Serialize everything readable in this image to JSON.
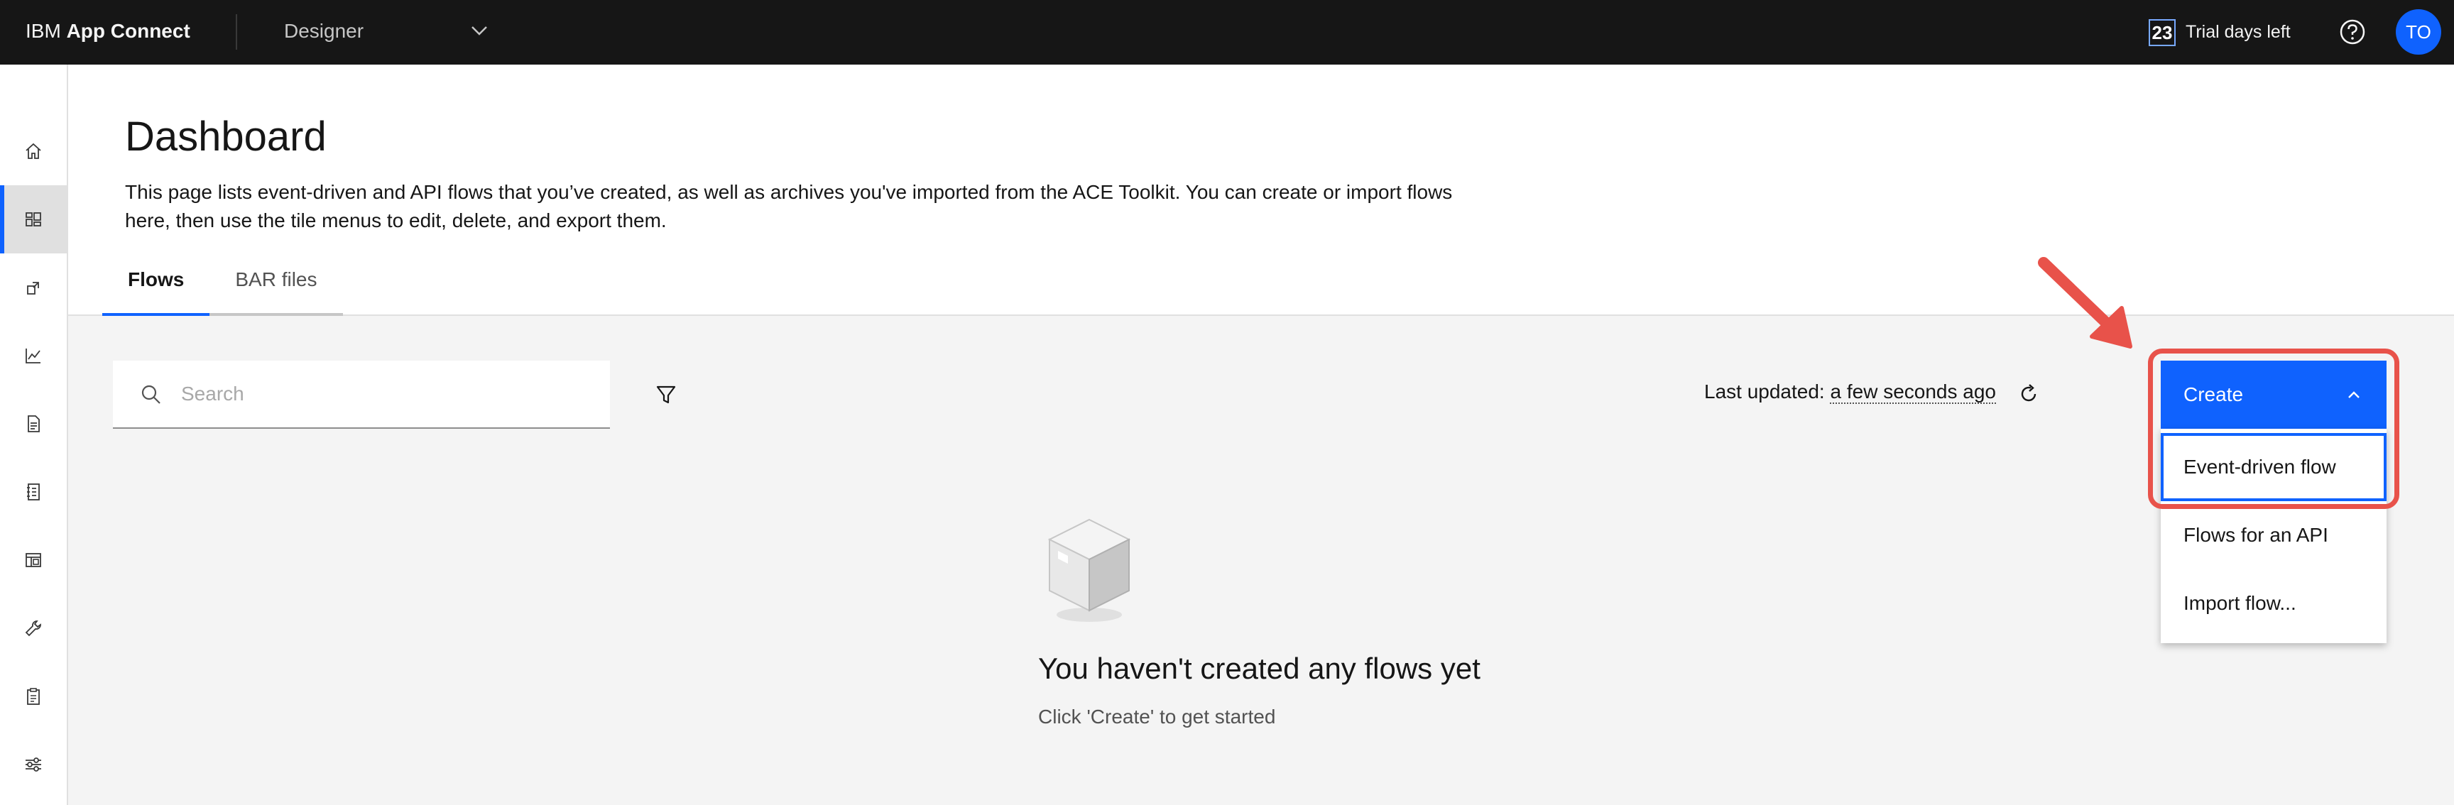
{
  "topbar": {
    "brand_prefix": "IBM ",
    "brand_name": "App Connect",
    "product": "Designer",
    "trial_days": "23",
    "trial_label": "Trial days left",
    "avatar_initials": "TO"
  },
  "sidenav": {
    "items": [
      {
        "icon": "home-icon"
      },
      {
        "icon": "dashboard-icon",
        "active": true
      },
      {
        "icon": "deploy-icon"
      },
      {
        "icon": "analytics-icon"
      },
      {
        "icon": "document-icon"
      },
      {
        "icon": "catalog-icon"
      },
      {
        "icon": "templates-icon"
      },
      {
        "icon": "tools-icon"
      },
      {
        "icon": "clipboard-icon"
      },
      {
        "icon": "settings-sliders-icon"
      }
    ]
  },
  "page": {
    "title": "Dashboard",
    "description": "This page lists event-driven and API flows that you’ve created, as well as archives you've imported from the ACE Toolkit. You can create or import flows here, then use the tile menus to edit, delete, and export them.",
    "tabs": [
      {
        "label": "Flows",
        "active": true
      },
      {
        "label": "BAR files",
        "active": false
      }
    ]
  },
  "toolbar": {
    "search_placeholder": "Search",
    "last_updated_label": "Last updated: ",
    "last_updated_value": "a few seconds ago",
    "create_label": "Create"
  },
  "create_menu": {
    "items": [
      "Event-driven flow",
      "Flows for an API",
      "Import flow..."
    ]
  },
  "empty_state": {
    "title": "You haven't created any flows yet",
    "subtitle": "Click 'Create' to get started"
  },
  "colors": {
    "accent": "#0f62fe",
    "annotation": "#e8524a",
    "topbar": "#161616"
  }
}
